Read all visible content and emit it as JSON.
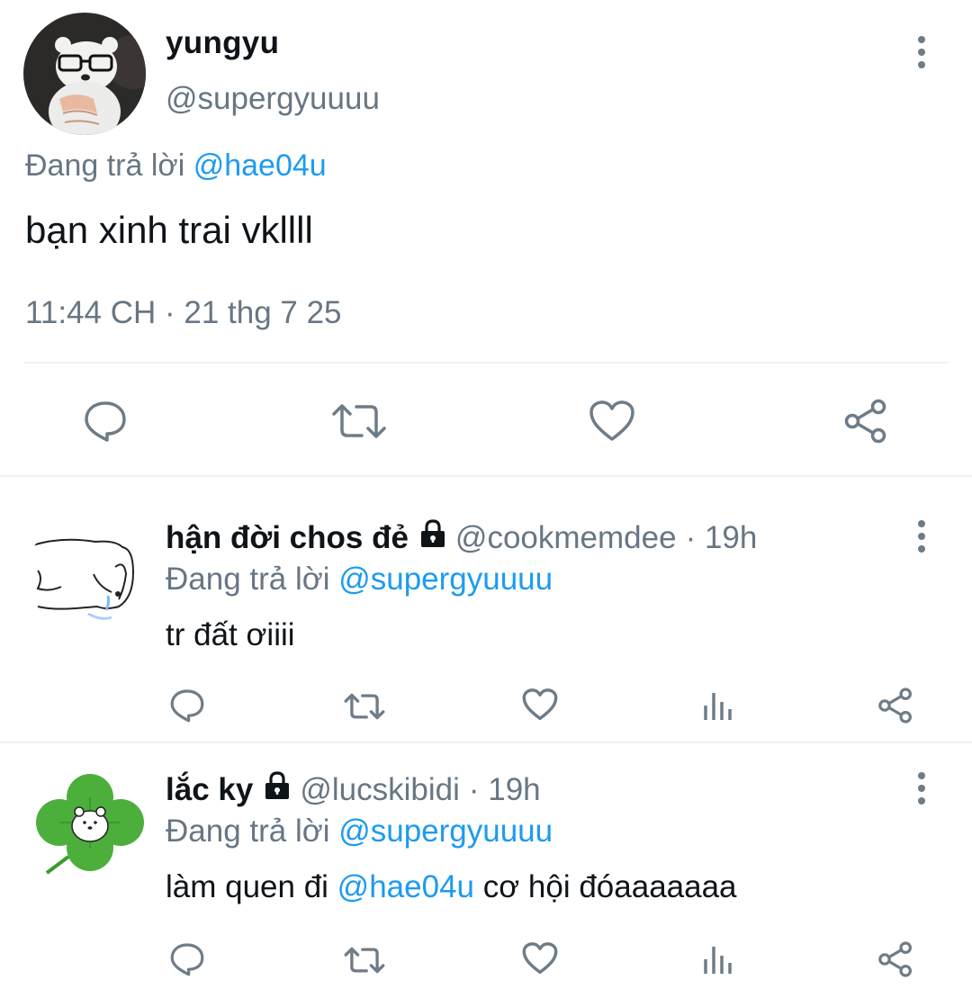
{
  "main_tweet": {
    "display_name": "yungyu",
    "handle": "@supergyuuuu",
    "replying_prefix": "Đang trả lời ",
    "replying_to": "@hae04u",
    "text": "bạn xinh trai vkllll",
    "timestamp": "11:44 CH · 21 thg 7 25",
    "avatar_icon": "bear-plush-avatar",
    "actions": [
      "reply-icon",
      "retweet-icon",
      "like-icon",
      "share-icon"
    ]
  },
  "replies": [
    {
      "display_name": "hận đời chos đẻ",
      "handle": "@cookmemdee",
      "time": "· 19h",
      "replying_prefix": "Đang trả lời ",
      "replying_to": "@supergyuuuu",
      "text": "tr đất ơiiii",
      "avatar_icon": "sketch-animal-avatar",
      "protected_icon": "lock-icon",
      "actions": [
        "reply-icon",
        "retweet-icon",
        "like-icon",
        "stats-icon",
        "share-icon"
      ]
    },
    {
      "display_name": "lắc ky",
      "handle": "@lucskibidi",
      "time": "· 19h",
      "replying_prefix": "Đang trả lời ",
      "replying_to": "@supergyuuuu",
      "text_prefix": "làm quen đi ",
      "text_mention": "@hae04u",
      "text_suffix": " cơ hội đóaaaaaaa",
      "avatar_icon": "clover-avatar",
      "protected_icon": "lock-icon",
      "actions": [
        "reply-icon",
        "retweet-icon",
        "like-icon",
        "stats-icon",
        "share-icon"
      ]
    }
  ],
  "colors": {
    "link": "#1d9bf0",
    "muted": "#687684",
    "icon": "#6e7c88",
    "divider": "#eff1f3",
    "clover": "#4caf3c"
  }
}
